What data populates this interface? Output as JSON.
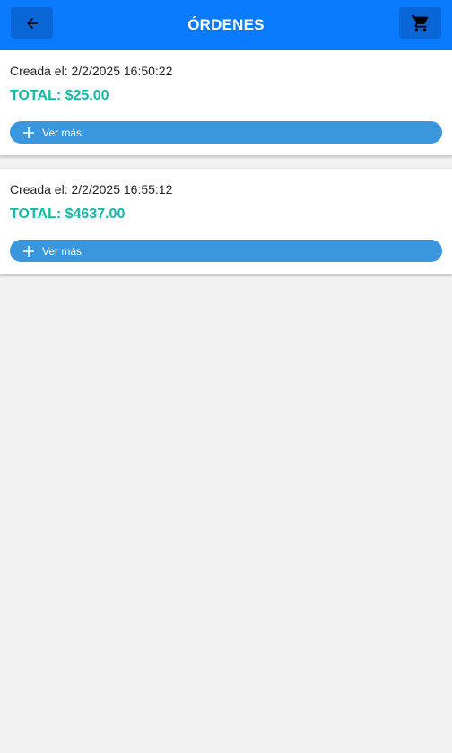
{
  "header": {
    "title": "ÓRDENES",
    "back_icon": "arrow-left-icon",
    "cart_icon": "cart-icon",
    "bg_color": "#0a7bff",
    "button_color": "#0866d6"
  },
  "orders": [
    {
      "date_text": "Creada el: 2/2/2025 16:50:22",
      "total_text": "TOTAL: $25.00",
      "more_label": "Ver más",
      "more_icon": "plus-icon"
    },
    {
      "date_text": "Creada el: 2/2/2025 16:55:12",
      "total_text": "TOTAL: $4637.00",
      "more_label": "Ver más",
      "more_icon": "plus-icon"
    }
  ],
  "colors": {
    "total": "#14b8a0",
    "more_button": "#3a96dd",
    "background": "#f2f2f2"
  }
}
